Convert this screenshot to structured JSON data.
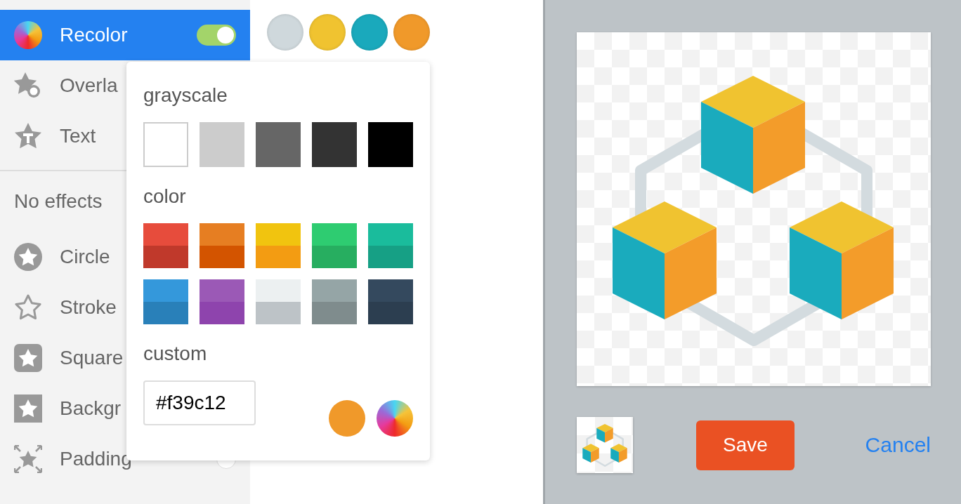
{
  "sidebar": {
    "effects": [
      {
        "label": "Recolor",
        "selected": true,
        "on": true
      },
      {
        "label": "Overla",
        "selected": false
      },
      {
        "label": "Text",
        "selected": false
      }
    ],
    "section_title": "No effects",
    "frames": [
      {
        "label": "Circle"
      },
      {
        "label": "Stroke"
      },
      {
        "label": "Square"
      },
      {
        "label": "Backgr"
      },
      {
        "label": "Padding",
        "checked": false
      }
    ]
  },
  "palette": [
    {
      "color": "#cfd8dc"
    },
    {
      "color": "#f0c330"
    },
    {
      "color": "#1aa9bc"
    },
    {
      "color": "#f0992a"
    }
  ],
  "color_popover": {
    "sections": [
      {
        "title": "grayscale",
        "swatches": [
          {
            "bands": [
              {
                "color": "#ffffff"
              }
            ]
          },
          {
            "bands": [
              {
                "color": "#cccccc"
              }
            ]
          },
          {
            "bands": [
              {
                "color": "#666666"
              }
            ]
          },
          {
            "bands": [
              {
                "color": "#333333"
              }
            ]
          },
          {
            "bands": [
              {
                "color": "#000000"
              }
            ]
          }
        ]
      },
      {
        "title": "color",
        "swatches": [
          {
            "bands": [
              {
                "color": "#e74c3c"
              },
              {
                "color": "#c0392b"
              }
            ]
          },
          {
            "bands": [
              {
                "color": "#e67e22"
              },
              {
                "color": "#d35400"
              }
            ]
          },
          {
            "bands": [
              {
                "color": "#f1c40f"
              },
              {
                "color": "#f39c12"
              }
            ]
          },
          {
            "bands": [
              {
                "color": "#2ecc71"
              },
              {
                "color": "#27ae60"
              }
            ]
          },
          {
            "bands": [
              {
                "color": "#1abc9c"
              },
              {
                "color": "#16a085"
              }
            ]
          },
          {
            "bands": [
              {
                "color": "#3498db"
              },
              {
                "color": "#2980b9"
              }
            ]
          },
          {
            "bands": [
              {
                "color": "#9b59b6"
              },
              {
                "color": "#8e44ad"
              }
            ]
          },
          {
            "bands": [
              {
                "color": "#ecf0f1"
              },
              {
                "color": "#bdc3c7"
              }
            ]
          },
          {
            "bands": [
              {
                "color": "#95a5a6"
              },
              {
                "color": "#7f8c8d"
              }
            ]
          },
          {
            "bands": [
              {
                "color": "#34495e"
              },
              {
                "color": "#2c3e50"
              }
            ]
          }
        ]
      }
    ],
    "custom": {
      "title": "custom",
      "value": "#f39c12",
      "color": "#f0992a"
    }
  },
  "actions": {
    "save": "Save",
    "cancel": "Cancel"
  }
}
